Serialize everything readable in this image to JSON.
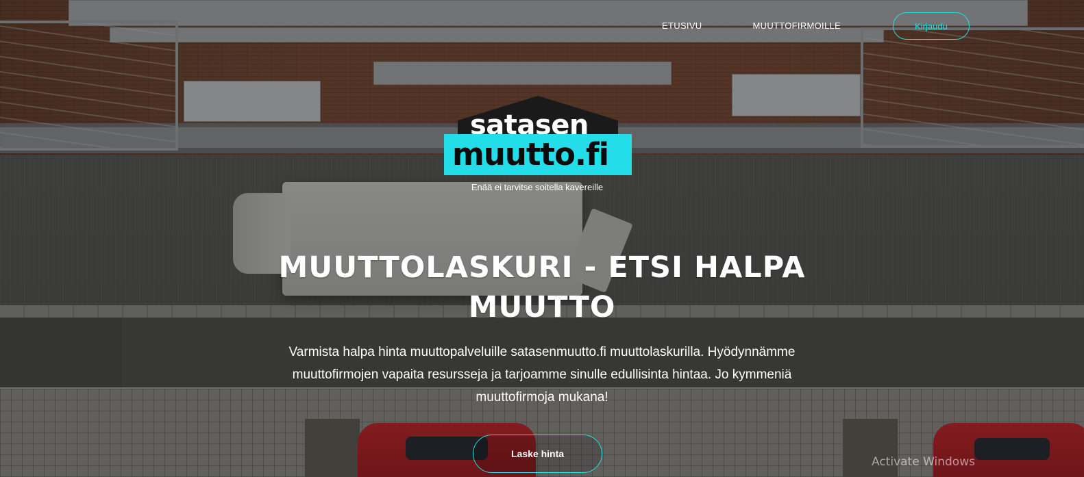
{
  "nav": {
    "items": [
      {
        "label": "ETUSIVU"
      },
      {
        "label": "MUUTTOFIRMOILLE"
      }
    ],
    "login_label": "Kirjaudu"
  },
  "logo": {
    "line1": "satasen",
    "line2": "muutto.fi",
    "tagline": "Enää ei tarvitse soitella kavereille"
  },
  "hero": {
    "title_line1": "MUUTTOLASKURI - ETSI HALPA",
    "title_line2": "MUUTTO",
    "description": "Varmista halpa hinta muuttopalveluille satasenmuutto.fi muuttolaskurilla. Hyödynnämme muuttofirmojen vapaita resursseja ja tarjoamme sinulle edullisinta hintaa. Jo kymmeniä muuttofirmoja mukana!",
    "cta_label": "Laske hinta"
  },
  "system": {
    "watermark": "Activate Windows"
  },
  "colors": {
    "accent": "#25e1e6",
    "logo_band": "#23dde8"
  }
}
